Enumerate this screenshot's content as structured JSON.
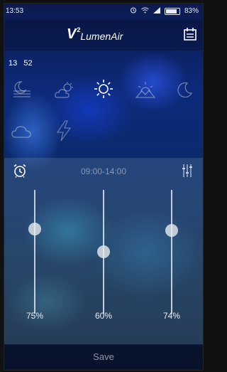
{
  "status_bar": {
    "time": "13:53",
    "battery": "83%"
  },
  "app": {
    "logo_v": "V",
    "logo_sup": "2",
    "logo_name": "LumenAir"
  },
  "clock": {
    "hours": "13",
    "minutes": "52"
  },
  "weather_modes": [
    {
      "name": "moonset-mode",
      "icon": "moon-horizon-icon",
      "selected": false
    },
    {
      "name": "cloudy-sun-mode",
      "icon": "cloud-sun-icon",
      "selected": false
    },
    {
      "name": "sunny-mode",
      "icon": "sun-icon",
      "selected": true
    },
    {
      "name": "sunset-mode",
      "icon": "sunset-icon",
      "selected": false
    },
    {
      "name": "night-mode",
      "icon": "crescent-moon-icon",
      "selected": false
    },
    {
      "name": "cloud-mode",
      "icon": "cloud-icon",
      "selected": false
    },
    {
      "name": "storm-mode",
      "icon": "lightning-icon",
      "selected": false
    }
  ],
  "schedule": {
    "time_range": "09:00-14:00"
  },
  "sliders": [
    {
      "label": "75%",
      "value": 75
    },
    {
      "label": "60%",
      "value": 60
    },
    {
      "label": "74%",
      "value": 74
    }
  ],
  "save_label": "Save",
  "colors": {
    "accent": "#ffffff",
    "muted_text": "#8f96a8"
  }
}
